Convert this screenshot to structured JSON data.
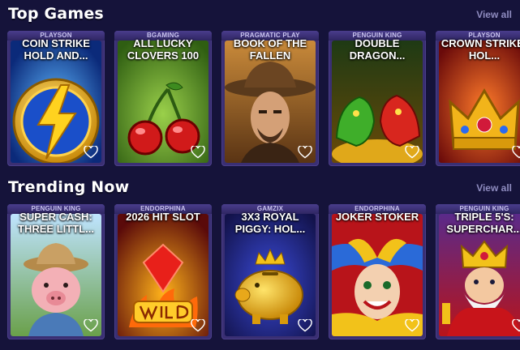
{
  "top_games": {
    "title": "Top Games",
    "view_all": "View all",
    "cards": [
      {
        "provider": "PLAYSON",
        "title": "COIN STRIKE HOLD AND...",
        "icon": "lightning-coin-icon"
      },
      {
        "provider": "BGAMING",
        "title": "ALL LUCKY CLOVERS 100",
        "icon": "cherries-icon"
      },
      {
        "provider": "PRAGMATIC PLAY",
        "title": "BOOK OF THE FALLEN",
        "icon": "cowboy-hero-icon"
      },
      {
        "provider": "PENGUIN KING",
        "title": "DOUBLE DRAGON...",
        "icon": "dragons-icon"
      },
      {
        "provider": "PLAYSON",
        "title": "CROWN STRIKE: HOL...",
        "icon": "crown-icon"
      }
    ]
  },
  "trending": {
    "title": "Trending Now",
    "view_all": "View all",
    "cards": [
      {
        "provider": "PENGUIN KING",
        "title": "SUPER CASH: THREE LITTL...",
        "icon": "pig-farmer-icon"
      },
      {
        "provider": "ENDORPHINA",
        "title": "2026 HIT SLOT",
        "icon": "wild-flame-icon"
      },
      {
        "provider": "GAMZIX",
        "title": "3X3 ROYAL PIGGY: HOL...",
        "icon": "golden-piggy-icon"
      },
      {
        "provider": "ENDORPHINA",
        "title": "JOKER STOKER",
        "icon": "joker-icon"
      },
      {
        "provider": "PENGUIN KING",
        "title": "TRIPLE 5'S: SUPERCHAR...",
        "icon": "king-icon"
      }
    ]
  },
  "colors": {
    "background": "#15133a",
    "view_all": "#8f8cc0",
    "card_frame": "#3a2f73"
  }
}
